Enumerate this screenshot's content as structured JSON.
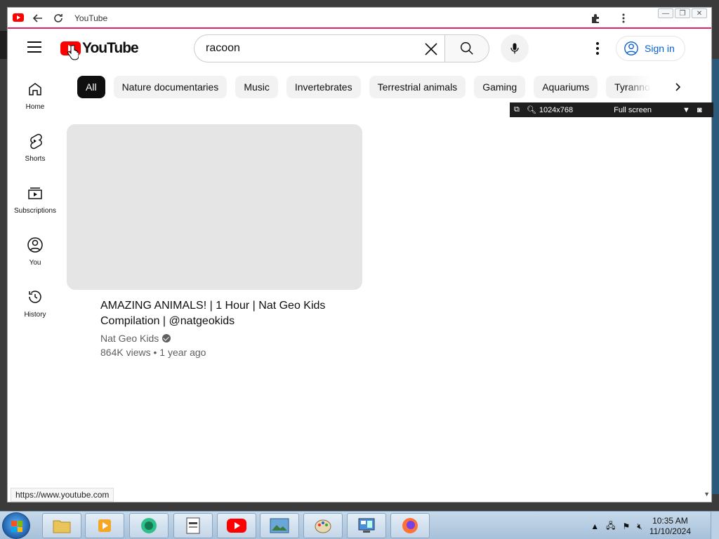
{
  "window": {
    "title": "YouTube",
    "controls": [
      "minimize",
      "restore",
      "close"
    ]
  },
  "header": {
    "logo_text": "YouTube",
    "search": {
      "value": "racoon",
      "placeholder": "Search"
    },
    "signin_label": "Sign in"
  },
  "sidebar": {
    "items": [
      {
        "label": "Home",
        "icon": "home-icon"
      },
      {
        "label": "Shorts",
        "icon": "shorts-icon"
      },
      {
        "label": "Subscriptions",
        "icon": "subscriptions-icon"
      },
      {
        "label": "You",
        "icon": "you-icon"
      },
      {
        "label": "History",
        "icon": "history-icon"
      }
    ]
  },
  "chips": [
    "All",
    "Nature documentaries",
    "Music",
    "Invertebrates",
    "Terrestrial animals",
    "Gaming",
    "Aquariums",
    "Tyrannosaurus"
  ],
  "active_chip": "All",
  "overlay": {
    "resolution": "1024x768",
    "mode": "Full screen"
  },
  "video": {
    "title": "AMAZING ANIMALS! | 1 Hour | Nat Geo Kids Compilation | @natgeokids",
    "channel": "Nat Geo Kids",
    "views": "864K views",
    "age": "1 year ago",
    "meta": "864K views • 1 year ago"
  },
  "status_url": "https://www.youtube.com",
  "taskbar": {
    "apps": [
      "file-explorer",
      "media-player",
      "browser-app",
      "document-viewer",
      "youtube-app",
      "image-viewer",
      "paint-app",
      "control-panel",
      "firefox"
    ],
    "clock": {
      "time": "10:35 AM",
      "date": "11/10/2024"
    }
  },
  "colors": {
    "brand_red": "#ff0000",
    "link_blue": "#065fd4",
    "chip_bg": "#f2f2f2",
    "active_chip": "#0f0f0f"
  }
}
